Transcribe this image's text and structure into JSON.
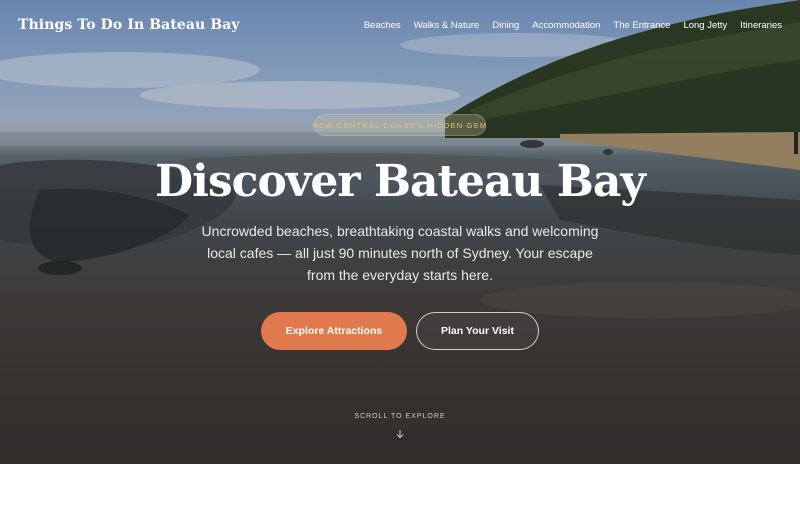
{
  "site": {
    "brand": "Things To Do In Bateau Bay"
  },
  "nav": {
    "items": [
      {
        "label": "Beaches"
      },
      {
        "label": "Walks & Nature"
      },
      {
        "label": "Dining"
      },
      {
        "label": "Accommodation"
      },
      {
        "label": "The Entrance"
      },
      {
        "label": "Long Jetty"
      },
      {
        "label": "Itineraries"
      }
    ]
  },
  "hero": {
    "badge": "NSW Central Coast's Hidden Gem",
    "title": "Discover Bateau Bay",
    "subtitle": "Uncrowded beaches, breathtaking coastal walks and welcoming local cafes — all just 90 minutes north of Sydney. Your escape from the everyday starts here.",
    "primary_cta": "Explore Attractions",
    "secondary_cta": "Plan Your Visit",
    "scroll_hint": "SCROLL TO EXPLORE",
    "scroll_icon": "arrow-down-icon"
  },
  "colors": {
    "accent": "#e07a4c",
    "badge_text": "#e9c07a",
    "text_light": "#ffffff"
  }
}
